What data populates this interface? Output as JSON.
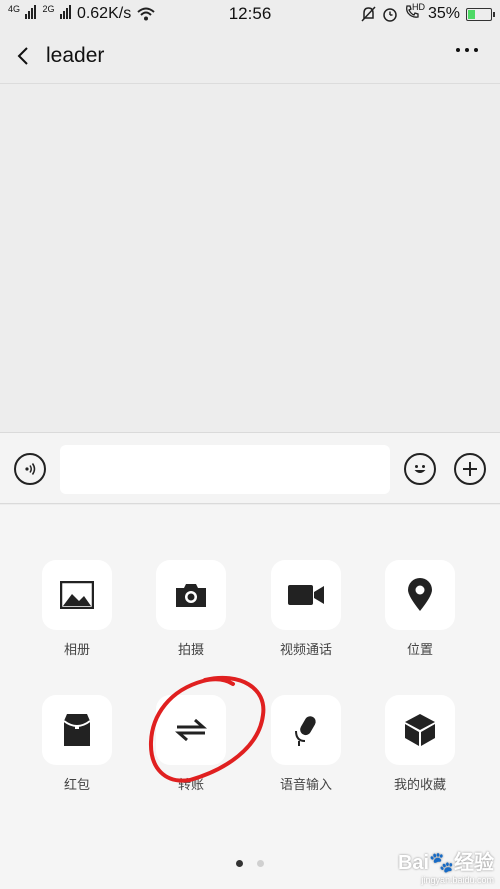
{
  "status_bar": {
    "net1": "4G",
    "net2": "2G",
    "speed": "0.62K/s",
    "time": "12:56",
    "hd": "HD",
    "battery": "35%",
    "battery_level": 0.35
  },
  "header": {
    "title": "leader"
  },
  "input_bar": {
    "placeholder": ""
  },
  "panel": {
    "tiles": [
      {
        "label": "相册",
        "icon": "photo-album-icon"
      },
      {
        "label": "拍摄",
        "icon": "camera-icon"
      },
      {
        "label": "视频通话",
        "icon": "video-call-icon"
      },
      {
        "label": "位置",
        "icon": "location-pin-icon"
      },
      {
        "label": "红包",
        "icon": "red-packet-icon"
      },
      {
        "label": "转账",
        "icon": "transfer-icon"
      },
      {
        "label": "语音输入",
        "icon": "microphone-icon"
      },
      {
        "label": "我的收藏",
        "icon": "favorites-cube-icon"
      }
    ],
    "page_index": 1,
    "page_count": 2
  },
  "watermark": {
    "line1": "Bai🐾经验",
    "line2": "jingyan.baidu.com"
  },
  "colors": {
    "annotation": "#e02020",
    "battery_fill": "#4cd964"
  }
}
